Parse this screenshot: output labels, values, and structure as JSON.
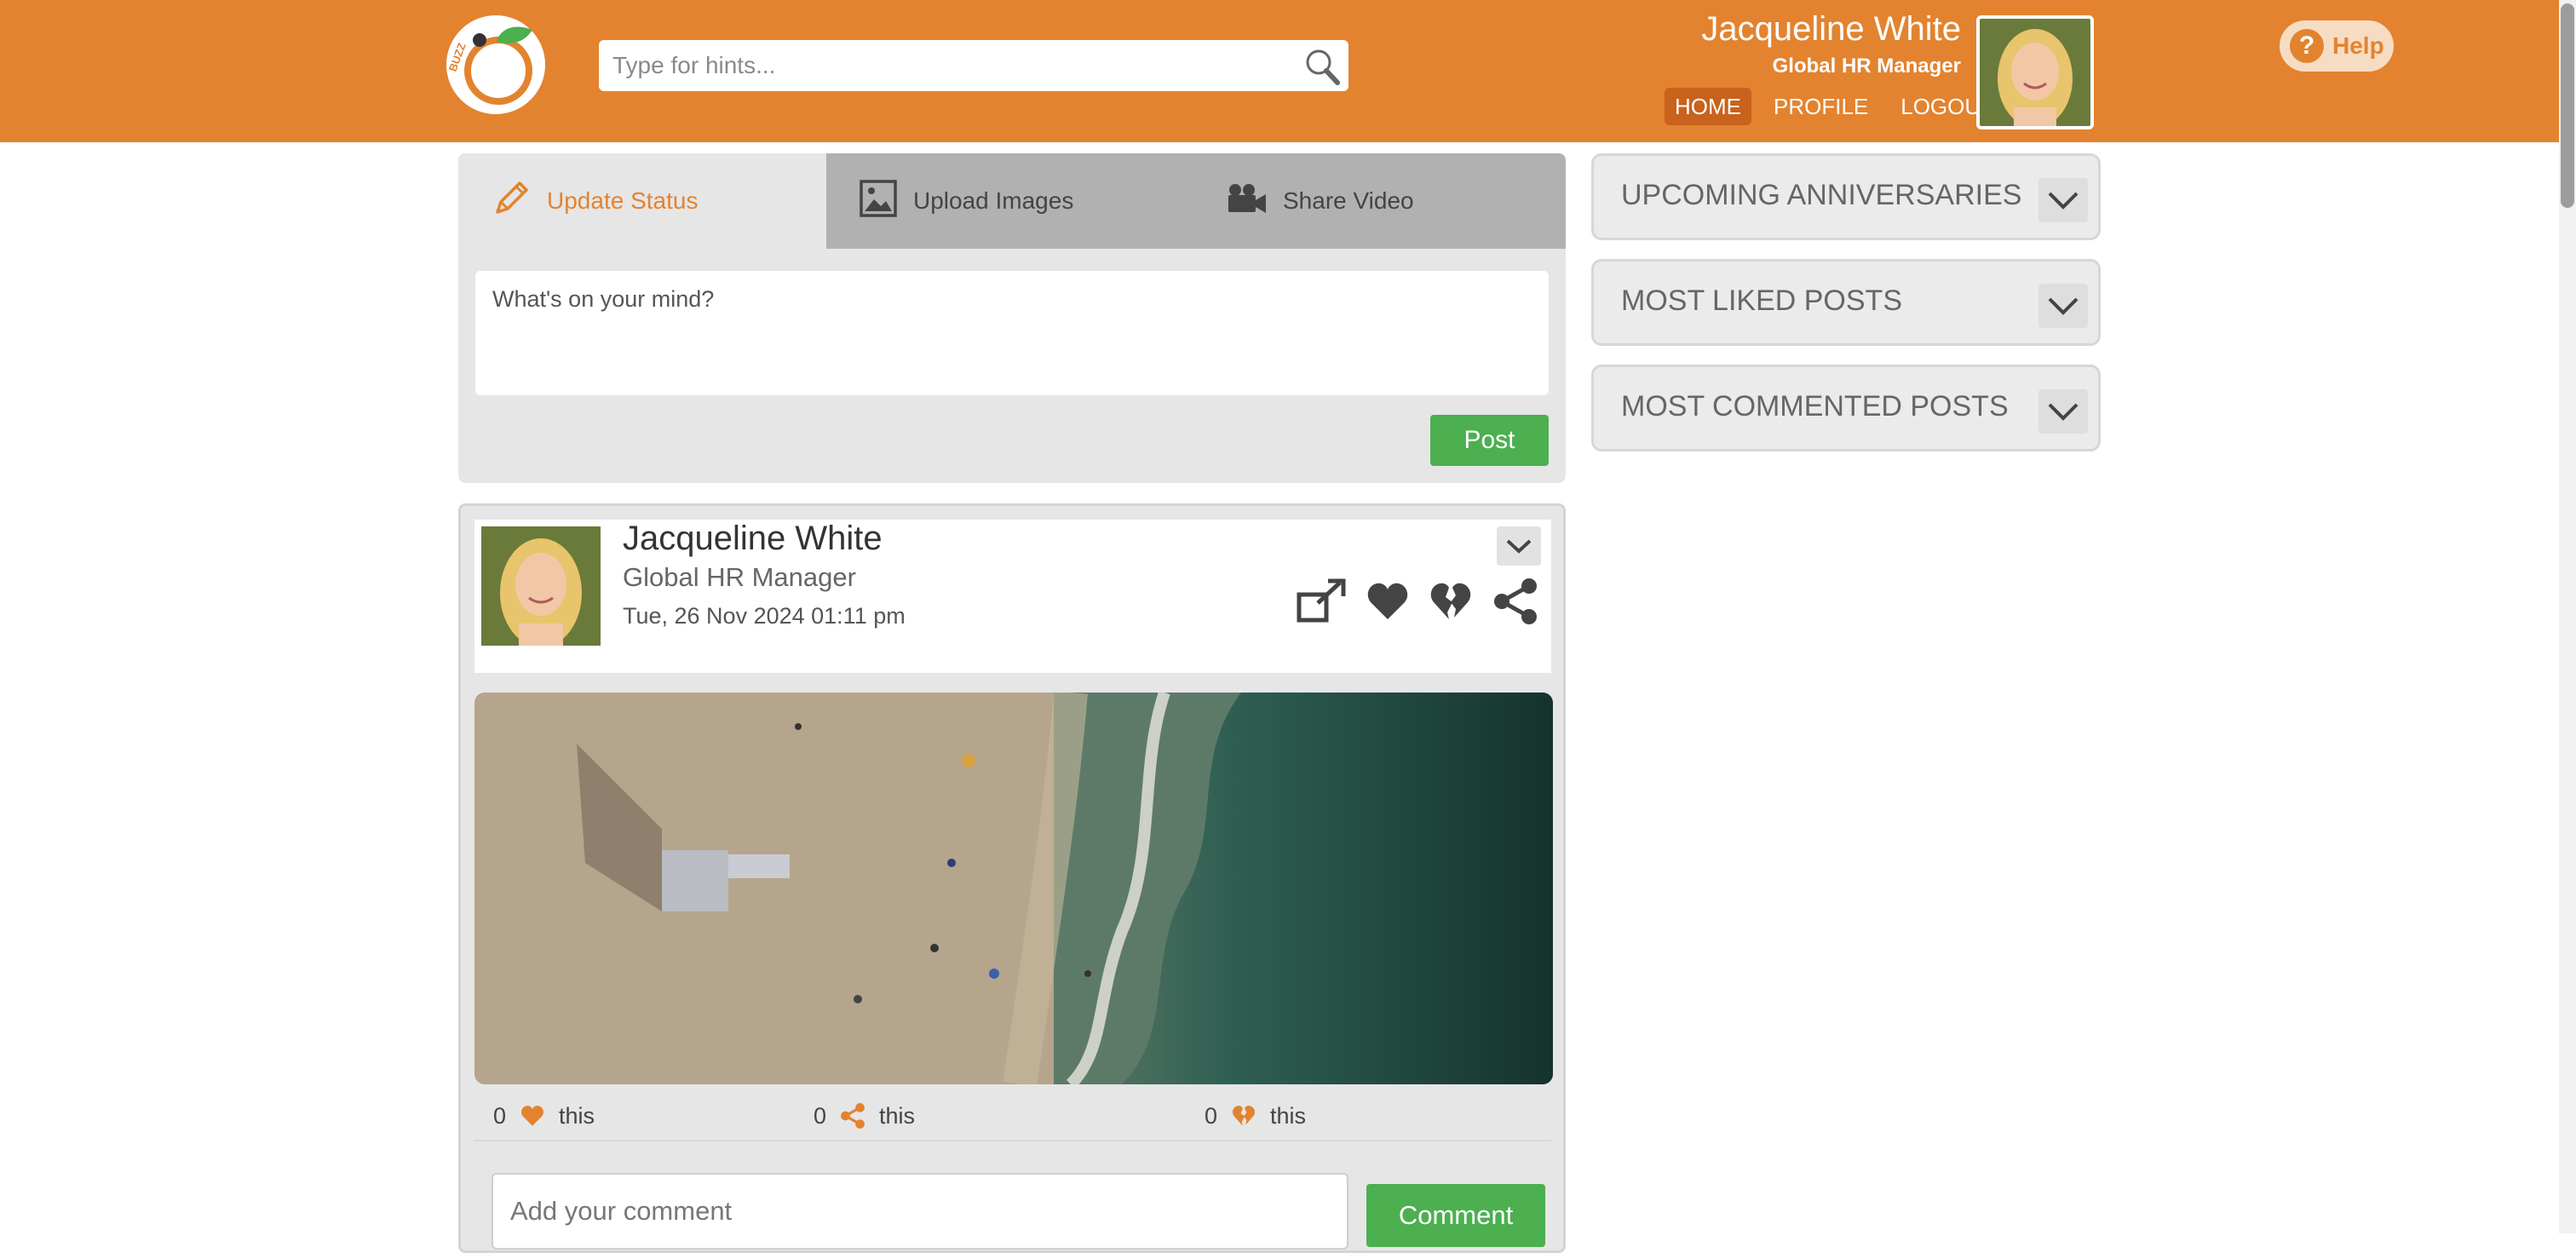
{
  "header": {
    "search_placeholder": "Type for hints...",
    "user_name": "Jacqueline White",
    "user_role": "Global HR Manager",
    "nav": [
      {
        "label": "HOME"
      },
      {
        "label": "PROFILE"
      },
      {
        "label": "LOGOUT"
      }
    ],
    "help_label": "Help",
    "colors": {
      "brand": "#e3832f",
      "active_nav": "#c8621c"
    }
  },
  "composer": {
    "tabs": [
      {
        "label": "Update Status",
        "icon": "pencil-icon"
      },
      {
        "label": "Upload Images",
        "icon": "image-icon"
      },
      {
        "label": "Share Video",
        "icon": "video-camera-icon"
      }
    ],
    "placeholder": "What's on your mind?",
    "post_label": "Post",
    "post_color": "#4caf50"
  },
  "sidebar": {
    "panels": [
      {
        "label": "UPCOMING ANNIVERSARIES"
      },
      {
        "label": "MOST LIKED POSTS"
      },
      {
        "label": "MOST COMMENTED POSTS"
      }
    ]
  },
  "post": {
    "author": "Jacqueline White",
    "role": "Global HR Manager",
    "date": "Tue, 26 Nov 2024  01:11 pm",
    "actions": [
      "open-external-icon",
      "heart-icon",
      "broken-heart-icon",
      "share-icon"
    ],
    "stats": [
      {
        "count": "0",
        "text": "this",
        "icon": "heart-icon"
      },
      {
        "count": "0",
        "text": "this",
        "icon": "share-icon"
      },
      {
        "count": "0",
        "text": "this",
        "icon": "broken-heart-icon"
      }
    ],
    "comment_placeholder": "Add your comment",
    "comment_label": "Comment"
  }
}
